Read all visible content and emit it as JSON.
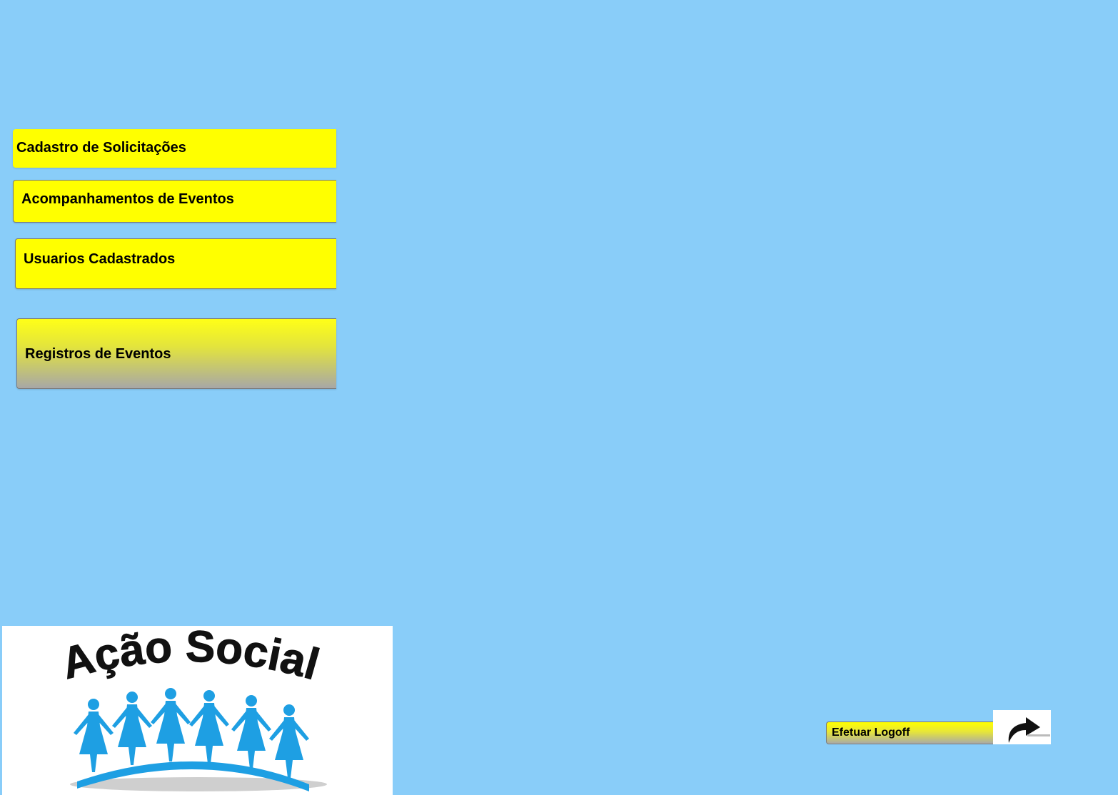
{
  "menu": {
    "items": [
      {
        "id": "cadastro",
        "label": "Cadastro de Solicitações"
      },
      {
        "id": "acompanhamentos",
        "label": "Acompanhamentos de Eventos"
      },
      {
        "id": "usuarios",
        "label": "Usuarios Cadastrados"
      },
      {
        "id": "registros",
        "label": "Registros de Eventos"
      }
    ]
  },
  "logo": {
    "text": "Ação Social",
    "icon": "people-holding-hands-icon",
    "text_color": "#111111",
    "figure_color": "#1e9fe3"
  },
  "logoff": {
    "label": "Efetuar Logoff",
    "icon": "forward-arrow-icon"
  },
  "colors": {
    "background": "#89cdf9",
    "button": "#ffff00"
  }
}
